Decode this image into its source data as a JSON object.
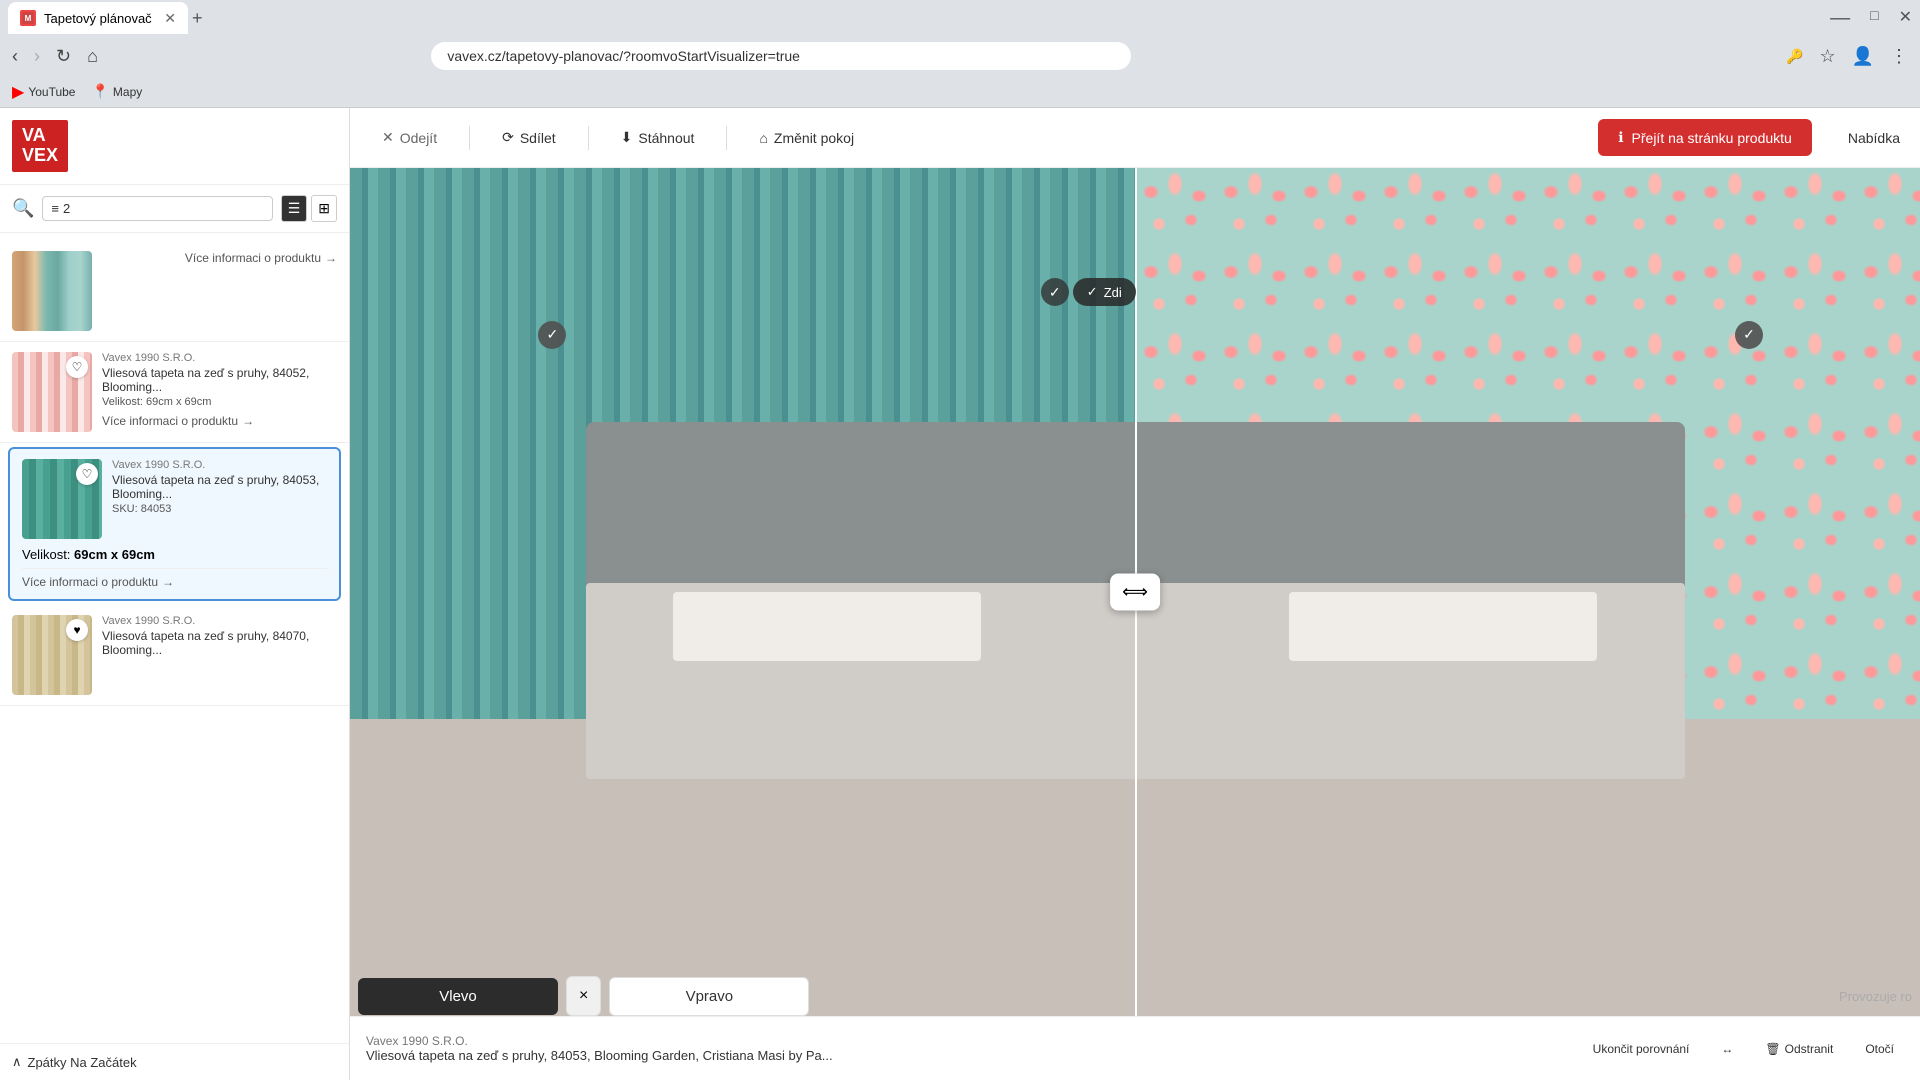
{
  "browser": {
    "tab_title": "Tapetový plánovač",
    "tab_favicon": "M",
    "address": "vavex.cz/tapetovy-planovac/?roomvoStartVisualizer=true",
    "new_tab_label": "+",
    "bookmarks": [
      {
        "id": "youtube",
        "label": "YouTube",
        "icon": "yt"
      },
      {
        "id": "mapy",
        "label": "Mapy",
        "icon": "maps"
      }
    ]
  },
  "logo": {
    "line1": "VA",
    "line2": "VEX"
  },
  "sidebar": {
    "filter_count": "2",
    "filter_icon": "≡",
    "view_list_icon": "☰",
    "view_grid_icon": "⊞",
    "products": [
      {
        "id": "product-strip-color",
        "brand": "",
        "name": "",
        "size": "",
        "sku": "",
        "more_text": "Více informaci o produktu",
        "swatch_class": "swatch-strip-1",
        "has_heart": false
      },
      {
        "id": "product-84052",
        "brand": "Vavex 1990 S.R.O.",
        "name": "Vliesová tapeta na zeď s pruhy, 84052, Blooming...",
        "size": "69cm x 69cm",
        "sku": "",
        "more_text": "Více informaci o produktu",
        "swatch_class": "swatch-strip-2",
        "has_heart": true
      },
      {
        "id": "product-84053",
        "brand": "Vavex 1990 S.R.O.",
        "name": "Vliesová tapeta na zeď s pruhy, 84053, Blooming...",
        "size": "69cm x 69cm",
        "sku": "84053",
        "more_text": "Více informaci o produktu",
        "swatch_class": "swatch-strip-3",
        "has_heart": true,
        "selected": true
      },
      {
        "id": "product-84070",
        "brand": "Vavex 1990 S.R.O.",
        "name": "Vliesová tapeta na zeď s pruhy, 84070, Blooming...",
        "size": "",
        "sku": "",
        "more_text": "",
        "swatch_class": "swatch-strip-4",
        "has_heart": true
      }
    ],
    "back_btn": "Zpátky Na Začátek"
  },
  "toolbar": {
    "leave_label": "Odejít",
    "share_label": "Sdílet",
    "download_label": "Stáhnout",
    "change_room_label": "Změnit pokoj",
    "go_to_product_label": "Přejít na stránku produktu",
    "nabidka_label": "Nabídka"
  },
  "room": {
    "wall_left_label": "Zdi",
    "wall_right_label": "Zdi",
    "check_icon": "✓"
  },
  "comparison": {
    "left_btn": "Vlevo",
    "close_btn": "×",
    "right_btn": "Vpravo",
    "provozuje_text": "Provozuje ro"
  },
  "product_info_bar": {
    "brand": "Vavex 1990 S.R.O.",
    "name": "Vliesová tapeta na zeď s pruhy, 84053, Blooming Garden, Cristiana Masi by Pa...",
    "end_comparison_label": "Ukončit porovnání",
    "swap_icon": "↔",
    "remove_label": "Odstranit",
    "rotate_label": "Otočí"
  }
}
